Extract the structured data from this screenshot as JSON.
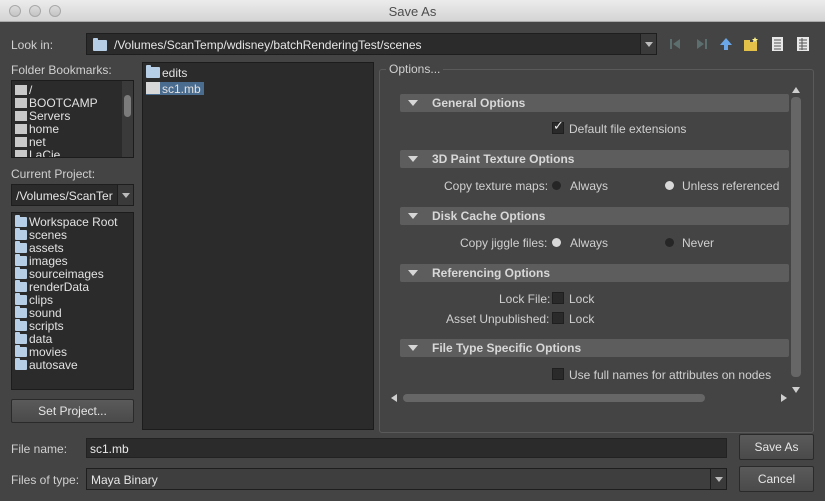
{
  "window": {
    "title": "Save As"
  },
  "look_in": {
    "label": "Look in:",
    "path": "/Volumes/ScanTemp/wdisney/batchRenderingTest/scenes"
  },
  "toolbar_icons": [
    "back-arrow-icon",
    "forward-arrow-icon",
    "up-arrow-icon",
    "new-folder-icon",
    "list-view-icon",
    "detail-view-icon"
  ],
  "bookmarks": {
    "label": "Folder Bookmarks:",
    "items": [
      "/",
      "BOOTCAMP",
      "Servers",
      "home",
      "net",
      "LaCie"
    ]
  },
  "current_project": {
    "label": "Current Project:",
    "value": "/Volumes/ScanTer",
    "folders": [
      "Workspace Root",
      "scenes",
      "assets",
      "images",
      "sourceimages",
      "renderData",
      "clips",
      "sound",
      "scripts",
      "data",
      "movies",
      "autosave"
    ]
  },
  "set_project_button": "Set Project...",
  "files": [
    {
      "name": "edits",
      "type": "folder"
    },
    {
      "name": "sc1.mb",
      "type": "maya-binary",
      "selected": true
    }
  ],
  "options": {
    "title": "Options...",
    "general": {
      "header": "General Options",
      "default_ext": "Default file extensions"
    },
    "paint": {
      "header": "3D Paint Texture Options",
      "label": "Copy texture maps:",
      "opt1": "Always",
      "opt2": "Unless referenced"
    },
    "cache": {
      "header": "Disk Cache Options",
      "label": "Copy jiggle files:",
      "opt1": "Always",
      "opt2": "Never"
    },
    "referencing": {
      "header": "Referencing Options",
      "lock_file_label": "Lock File:",
      "lock_file_cb": "Lock",
      "asset_label": "Asset Unpublished:",
      "asset_cb": "Lock"
    },
    "filetype": {
      "header": "File Type Specific Options",
      "full_names": "Use full names for attributes on nodes"
    }
  },
  "file_name": {
    "label": "File name:",
    "value": "sc1.mb"
  },
  "file_type": {
    "label": "Files of type:",
    "value": "Maya Binary"
  },
  "buttons": {
    "save": "Save As",
    "cancel": "Cancel"
  },
  "colors": {
    "accent": "#4a6c8f",
    "background": "#444444"
  }
}
